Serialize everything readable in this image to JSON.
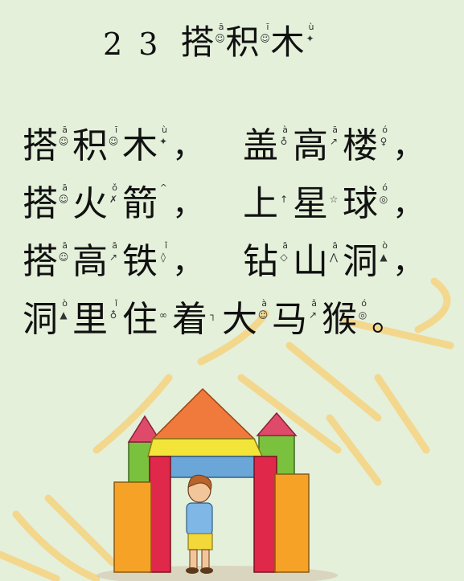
{
  "lesson": {
    "number": "2 3",
    "title": [
      {
        "char": "搭",
        "tone": "ā",
        "hint": "☺"
      },
      {
        "char": "积",
        "tone": "ī",
        "hint": "☺"
      },
      {
        "char": "木",
        "tone": "ù",
        "hint": "✦"
      }
    ]
  },
  "poem": {
    "lines": [
      {
        "left": [
          {
            "char": "搭",
            "tone": "ā",
            "hint": "☺"
          },
          {
            "char": "积",
            "tone": "ī",
            "hint": "☺"
          },
          {
            "char": "木",
            "tone": "ù",
            "hint": "✦"
          }
        ],
        "mid": "，",
        "right": [
          {
            "char": "盖",
            "tone": "à",
            "hint": "♁"
          },
          {
            "char": "高",
            "tone": "ā",
            "hint": "↗"
          },
          {
            "char": "楼",
            "tone": "ó",
            "hint": "♀"
          }
        ],
        "end": "，"
      },
      {
        "left": [
          {
            "char": "搭",
            "tone": "ā",
            "hint": "☺"
          },
          {
            "char": "火",
            "tone": "ǒ",
            "hint": "✗"
          },
          {
            "char": "箭",
            "tone": "^",
            "hint": ""
          }
        ],
        "mid": "，",
        "right": [
          {
            "char": "上",
            "tone": "",
            "hint": "↑"
          },
          {
            "char": "星",
            "tone": "",
            "hint": "☆"
          },
          {
            "char": "球",
            "tone": "ó",
            "hint": "◎"
          }
        ],
        "end": "，"
      },
      {
        "left": [
          {
            "char": "搭",
            "tone": "ā",
            "hint": "☺"
          },
          {
            "char": "高",
            "tone": "ā",
            "hint": "↗"
          },
          {
            "char": "铁",
            "tone": "ǐ",
            "hint": "◊"
          }
        ],
        "mid": "，",
        "right": [
          {
            "char": "钻",
            "tone": "ā",
            "hint": "◇"
          },
          {
            "char": "山",
            "tone": "ā",
            "hint": "⋀"
          },
          {
            "char": "洞",
            "tone": "ò",
            "hint": "▲"
          }
        ],
        "end": "，"
      },
      {
        "left": [
          {
            "char": "洞",
            "tone": "ò",
            "hint": "▲"
          },
          {
            "char": "里",
            "tone": "ǐ",
            "hint": "♁"
          },
          {
            "char": "住",
            "tone": "",
            "hint": "∞"
          },
          {
            "char": "着",
            "tone": "",
            "hint": "┐"
          }
        ],
        "mid": "",
        "right": [
          {
            "char": "大",
            "tone": "à",
            "hint": "☺"
          },
          {
            "char": "马",
            "tone": "ǎ",
            "hint": "↗"
          },
          {
            "char": "猴",
            "tone": "ó",
            "hint": "◎"
          }
        ],
        "end": "。"
      }
    ]
  },
  "colors": {
    "background": "#e4f0da",
    "watermark": "#f7d27a",
    "roof": "#f07a3c",
    "tower_pink": "#e04a6a",
    "block_green": "#7ac23e",
    "block_yellow": "#f3e43a",
    "block_red": "#e0284a",
    "block_orange": "#f5a227",
    "block_blue": "#6aa6d8"
  },
  "icons": {
    "illustration": "boy-with-building-blocks",
    "watermark": "seal-watermark"
  }
}
